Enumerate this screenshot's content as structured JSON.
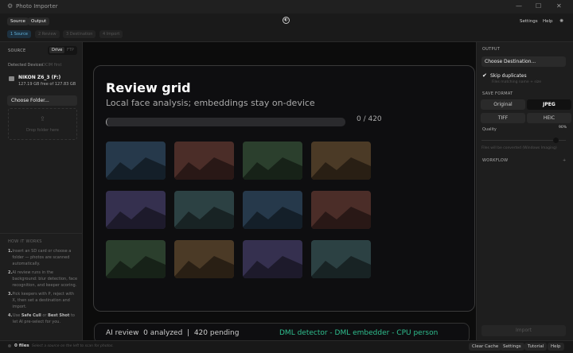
{
  "app": {
    "title": "Photo Importer"
  },
  "top": {
    "tabs": [
      "Source",
      "Output"
    ],
    "settings": "Settings",
    "help": "Help"
  },
  "steps": [
    "1 Source",
    "2 Review",
    "3 Destination",
    "4 Import"
  ],
  "left": {
    "source_label": "SOURCE",
    "toggle": [
      "Drive",
      "FTP"
    ],
    "detected": "Detected Devices",
    "dcim": "DCIM first",
    "device_name": "NIKON Z6_3 (F:)",
    "device_space": "127.19 GB free of 127.83 GB",
    "choose_folder": "Choose Folder...",
    "drop": "Drop folder here",
    "how_title": "HOW IT WORKS",
    "how": [
      {
        "n": "1.",
        "t": "Insert an SD card or choose a folder — photos are scanned automatically."
      },
      {
        "n": "2.",
        "t": "AI review runs in the background: blur detection, face recognition, and keeper scoring."
      },
      {
        "n": "3.",
        "t": "Pick keepers with P, reject with X, then set a destination and import."
      }
    ],
    "how4": {
      "n": "4.",
      "a": "Use ",
      "b": "Safe Cull",
      "c": " or ",
      "d": "Best Shot",
      "e": " to let AI pre-select for you."
    }
  },
  "card": {
    "title": "Review grid",
    "subtitle": "Local face analysis; embeddings stay on-device",
    "progress_text": "0 / 420",
    "progress": 0,
    "tiles": [
      "#26394b",
      "#4b2d28",
      "#2b3f2d",
      "#4b3a26",
      "#35304f",
      "#2c4143",
      "#26394b",
      "#4b2d28",
      "#2b3f2d",
      "#4b3a26",
      "#35304f",
      "#2c4143"
    ]
  },
  "review_bar": {
    "label": "AI review",
    "analyzed": "0 analyzed",
    "sep": "|",
    "pending": "420 pending",
    "engines": "DML detector - DML embedder - CPU person",
    "engine_color": "#2fbf8f"
  },
  "right": {
    "output": "OUTPUT",
    "choose_dest": "Choose Destination...",
    "skip": "Skip duplicates",
    "skip_checked": true,
    "skip_hint": "Files matching name + size",
    "save_format": "SAVE FORMAT",
    "formats": [
      "Original",
      "JPEG",
      "TIFF",
      "HEIC"
    ],
    "selected_format": "JPEG",
    "quality": "Quality",
    "quality_value": "90%",
    "quality_level": 90,
    "convert_hint": "Files will be converted (Windows Imaging)",
    "workflow": "WORKFLOW",
    "workflow_toggle": "+",
    "import": "Import"
  },
  "status": {
    "files": "0 files",
    "hint": "Select a source on the left to scan for photos.",
    "buttons": [
      "Clear Cache",
      "Settings",
      "Tutorial",
      "Help"
    ]
  }
}
